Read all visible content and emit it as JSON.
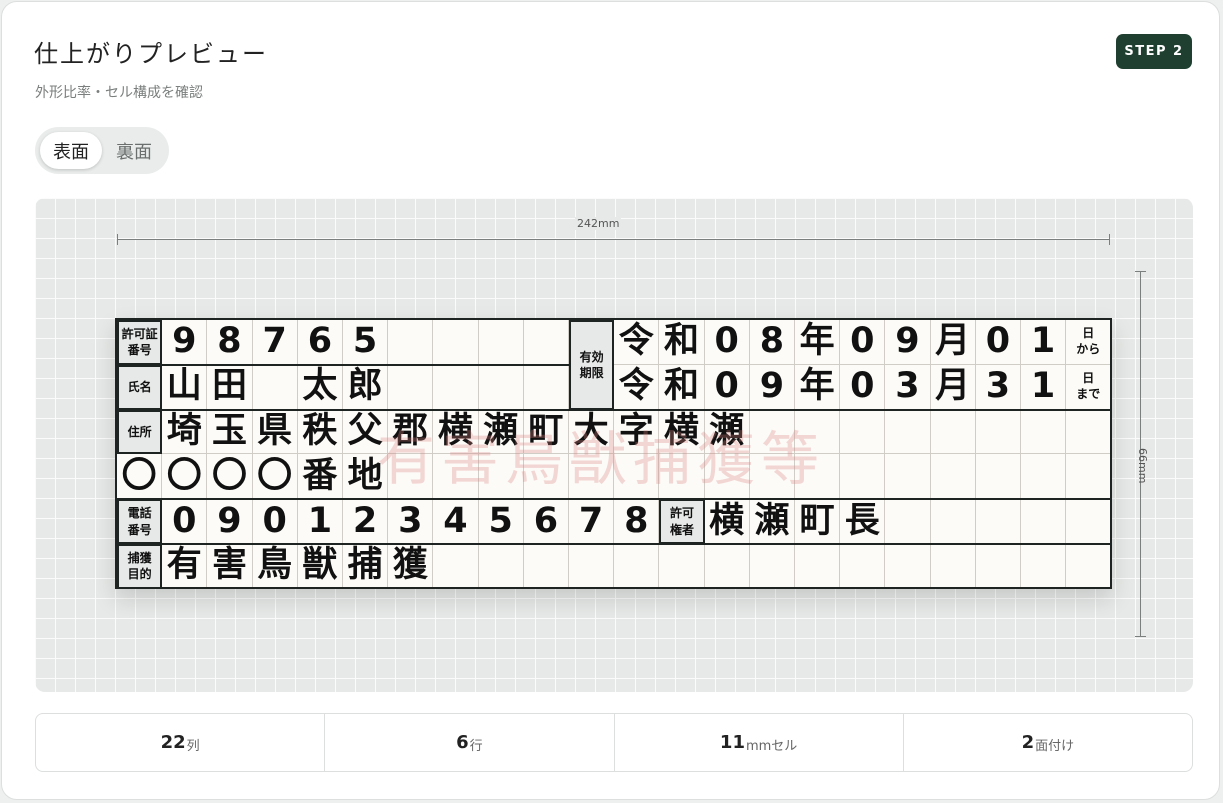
{
  "header": {
    "title": "仕上がりプレビュー",
    "subtitle": "外形比率・セル構成を確認",
    "step_badge": "STEP 2"
  },
  "face_toggle": {
    "options": [
      "表面",
      "裏面"
    ],
    "selected": "表面"
  },
  "preview": {
    "width_label": "242mm",
    "height_label": "66mm",
    "watermark": "有害鳥獣捕獲等",
    "plate": {
      "row1": {
        "label": "許可証\n番号",
        "digits": [
          "9",
          "8",
          "7",
          "6",
          "5",
          "",
          "",
          "",
          ""
        ],
        "validity_label": "有効\n期限",
        "chars": [
          "令",
          "和",
          "0",
          "8",
          "年",
          "0",
          "9",
          "月",
          "0",
          "1"
        ],
        "suffix": "日\nから"
      },
      "row2": {
        "label": "氏名",
        "chars": [
          "山",
          "田",
          "",
          "太",
          "郎",
          "",
          "",
          "",
          ""
        ],
        "chars2": [
          "令",
          "和",
          "0",
          "9",
          "年",
          "0",
          "3",
          "月",
          "3",
          "1"
        ],
        "suffix": "日\nまで"
      },
      "row3": {
        "label": "住所",
        "chars": [
          "埼",
          "玉",
          "県",
          "秩",
          "父",
          "郡",
          "横",
          "瀬",
          "町",
          "大",
          "字",
          "横",
          "瀬",
          "",
          "",
          "",
          "",
          "",
          "",
          "",
          ""
        ]
      },
      "row4": {
        "chars": [
          "〇",
          "〇",
          "〇",
          "〇",
          "番",
          "地",
          "",
          "",
          "",
          "",
          "",
          "",
          "",
          "",
          "",
          "",
          "",
          "",
          "",
          "",
          "",
          ""
        ]
      },
      "row5": {
        "label": "電話\n番号",
        "digits": [
          "0",
          "9",
          "0",
          "1",
          "2",
          "3",
          "4",
          "5",
          "6",
          "7",
          "8"
        ],
        "permit_label": "許可\n権者",
        "chars": [
          "横",
          "瀬",
          "町",
          "長",
          "",
          "",
          "",
          "",
          "",
          ""
        ]
      },
      "row6": {
        "label": "捕獲\n目的",
        "chars": [
          "有",
          "害",
          "鳥",
          "獣",
          "捕",
          "獲",
          "",
          "",
          "",
          "",
          "",
          "",
          "",
          "",
          "",
          "",
          "",
          "",
          "",
          "",
          ""
        ]
      }
    }
  },
  "stats": [
    {
      "num": "22",
      "unit": "列"
    },
    {
      "num": "6",
      "unit": "行"
    },
    {
      "num": "11",
      "unit": "mmセル"
    },
    {
      "num": "2",
      "unit": "面付け"
    }
  ]
}
